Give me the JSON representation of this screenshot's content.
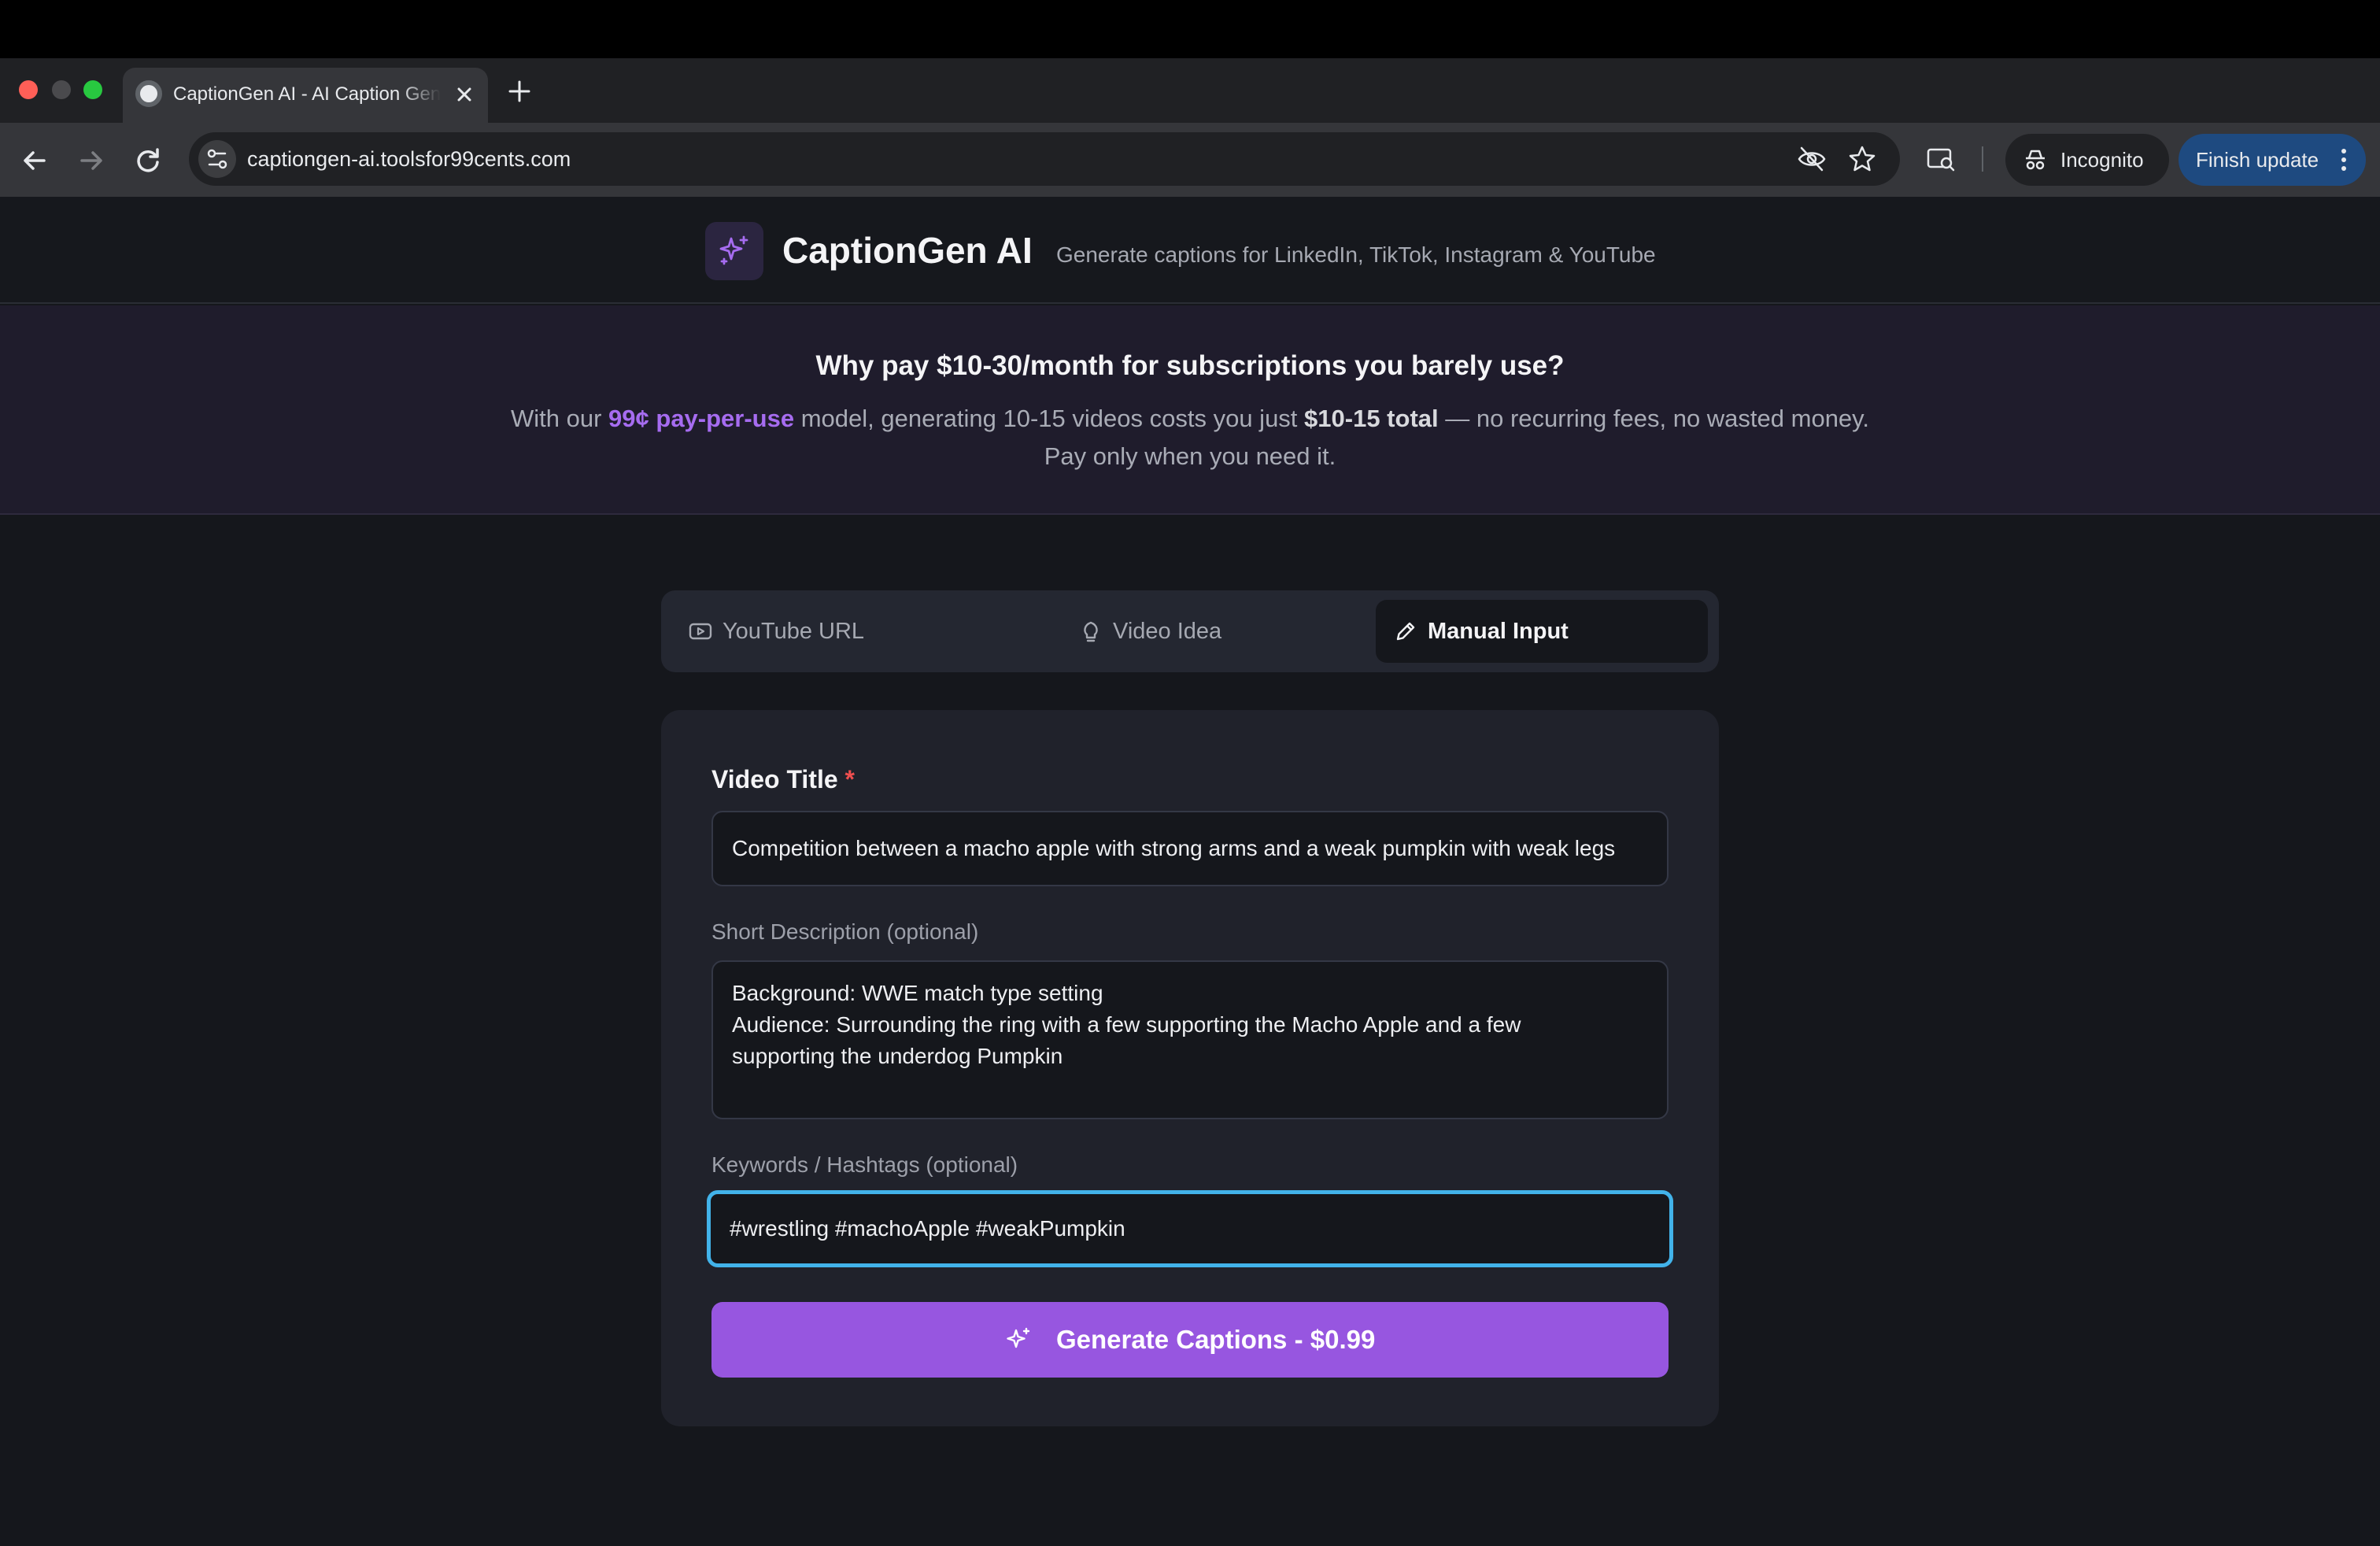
{
  "browser": {
    "tab_title": "CaptionGen AI - AI Caption Generator",
    "url": "captiongen-ai.toolsfor99cents.com",
    "incognito_label": "Incognito",
    "finish_update_label": "Finish update"
  },
  "header": {
    "brand": "CaptionGen AI",
    "tagline": "Generate captions for LinkedIn, TikTok, Instagram & YouTube"
  },
  "promo": {
    "title": "Why pay $10-30/month for subscriptions you barely use?",
    "body_prefix": "With our ",
    "highlight": "99¢ pay-per-use",
    "body_middle": " model, generating 10-15 videos costs you just ",
    "strong": "$10-15 total",
    "body_suffix": " — no recurring fees, no wasted money. Pay only when you need it."
  },
  "tabs": [
    {
      "label": "YouTube URL",
      "icon": "youtube-icon",
      "active": false
    },
    {
      "label": "Video Idea",
      "icon": "lightbulb-icon",
      "active": false
    },
    {
      "label": "Manual Input",
      "icon": "pencil-icon",
      "active": true
    }
  ],
  "form": {
    "title_label": "Video Title",
    "required_mark": "*",
    "title_value": "Competition between a macho apple with strong arms and a weak pumpkin with weak legs",
    "description_label": "Short Description (optional)",
    "description_lines": [
      "Background: WWE match type setting",
      "Audience: Surrounding the ring with a few supporting the Macho Apple and a few",
      "supporting the underdog Pumpkin"
    ],
    "keywords_label": "Keywords / Hashtags (optional)",
    "keywords_value": "#wrestling #machoApple #weakPumpkin",
    "generate_label": "Generate Captions - $0.99"
  },
  "colors": {
    "accent": "#9756e0",
    "highlight": "#a66cf0",
    "focus_ring": "#42b3ea",
    "required": "#ef4f4f"
  }
}
